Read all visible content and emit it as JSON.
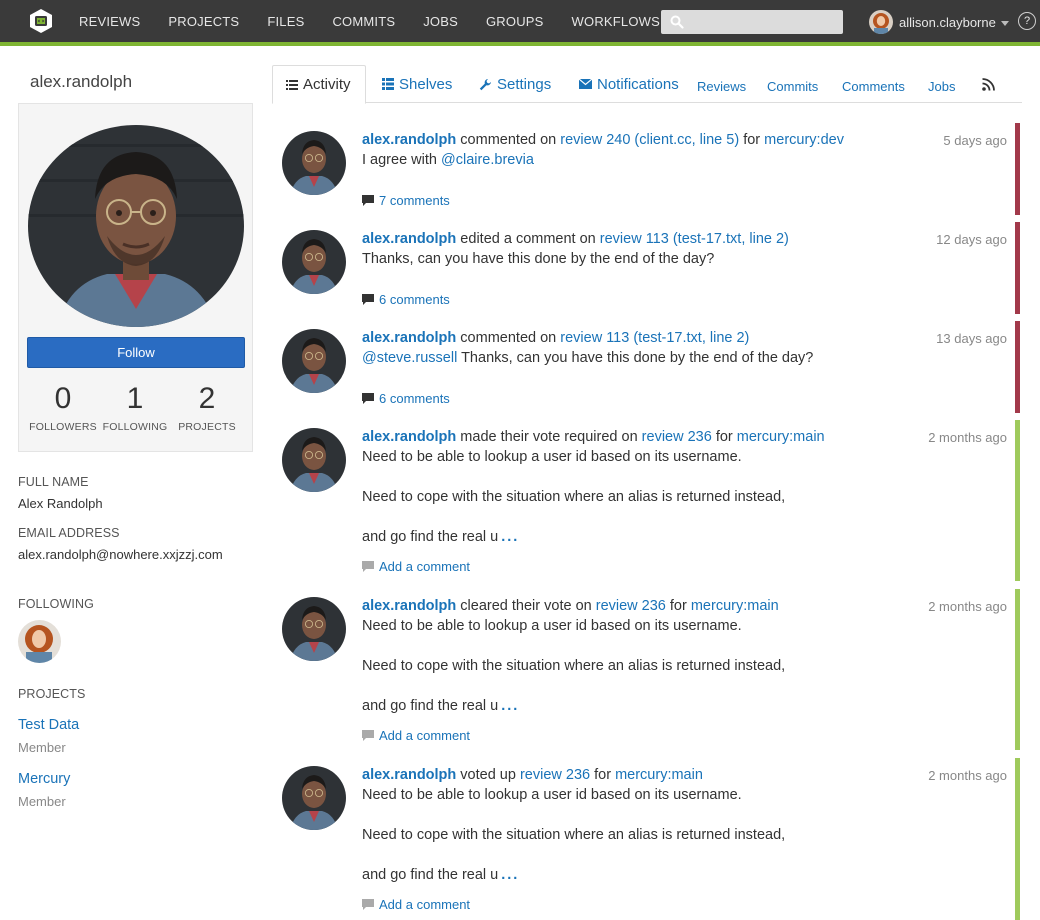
{
  "nav": {
    "items": [
      "REVIEWS",
      "PROJECTS",
      "FILES",
      "COMMITS",
      "JOBS",
      "GROUPS",
      "WORKFLOWS"
    ],
    "search_value": "",
    "user_name": "allison.clayborne",
    "help_label": "?"
  },
  "profile": {
    "username": "alex.randolph",
    "follow_label": "Follow",
    "stats": [
      {
        "value": "0",
        "label": "FOLLOWERS"
      },
      {
        "value": "1",
        "label": "FOLLOWING"
      },
      {
        "value": "2",
        "label": "PROJECTS"
      }
    ],
    "full_name_label": "FULL NAME",
    "full_name": "Alex Randolph",
    "email_label": "EMAIL ADDRESS",
    "email": "alex.randolph@nowhere.xxjzzj.com",
    "following_label": "FOLLOWING",
    "projects_label": "PROJECTS",
    "projects": [
      {
        "name": "Test Data",
        "role": "Member"
      },
      {
        "name": "Mercury",
        "role": "Member"
      }
    ]
  },
  "tabs": [
    {
      "label": "Activity",
      "icon": "list-icon",
      "active": true
    },
    {
      "label": "Shelves",
      "icon": "grid-icon"
    },
    {
      "label": "Settings",
      "icon": "wrench-icon"
    },
    {
      "label": "Notifications",
      "icon": "envelope-icon"
    },
    {
      "label": "Reviews"
    },
    {
      "label": "Commits"
    },
    {
      "label": "Comments"
    },
    {
      "label": "Jobs"
    },
    {
      "label": "",
      "icon": "rss-icon"
    }
  ],
  "feed": [
    {
      "author": "alex.randolph",
      "action": " commented on ",
      "target": "review 240 (client.cc, line 5)",
      "for_text": " for ",
      "project": "mercury:dev",
      "time": "5 days ago",
      "body_prefix": "I agree with ",
      "body_mention": "@claire.brevia",
      "comments": "7 comments",
      "status_color": "#a2394a"
    },
    {
      "author": "alex.randolph",
      "action": " edited a comment on ",
      "target": "review 113 (test-17.txt, line 2)",
      "time": "12 days ago",
      "body": "Thanks, can you have this done by the end of the day?",
      "comments": "6 comments",
      "status_color": "#a2394a"
    },
    {
      "author": "alex.randolph",
      "action": " commented on ",
      "target": "review 113 (test-17.txt, line 2)",
      "time": "13 days ago",
      "body_mention": "@steve.russell",
      "body": " Thanks, can you have this done by the end of the day?",
      "comments": "6 comments",
      "status_color": "#a2394a"
    },
    {
      "author": "alex.randolph",
      "action": " made their vote required on ",
      "target": "review 236",
      "for_text": " for ",
      "project": "mercury:main",
      "time": "2 months ago",
      "body_lines": [
        "Need to be able to lookup a user id based on its username.",
        "Need to cope with the situation where an alias is returned instead,",
        "and go find the real u"
      ],
      "ellipsis": "...",
      "comments": "Add a comment",
      "status_color": "#9fca5c"
    },
    {
      "author": "alex.randolph",
      "action": " cleared their vote on ",
      "target": "review 236",
      "for_text": " for ",
      "project": "mercury:main",
      "time": "2 months ago",
      "body_lines": [
        "Need to be able to lookup a user id based on its username.",
        "Need to cope with the situation where an alias is returned instead,",
        "and go find the real u"
      ],
      "ellipsis": "...",
      "comments": "Add a comment",
      "status_color": "#9fca5c"
    },
    {
      "author": "alex.randolph",
      "action": " voted up ",
      "target": "review 236",
      "for_text": " for ",
      "project": "mercury:main",
      "time": "2 months ago",
      "body_lines": [
        "Need to be able to lookup a user id based on its username.",
        "Need to cope with the situation where an alias is returned instead,",
        "and go find the real u"
      ],
      "ellipsis": "...",
      "comments": "Add a comment",
      "status_color": "#9fca5c"
    }
  ]
}
